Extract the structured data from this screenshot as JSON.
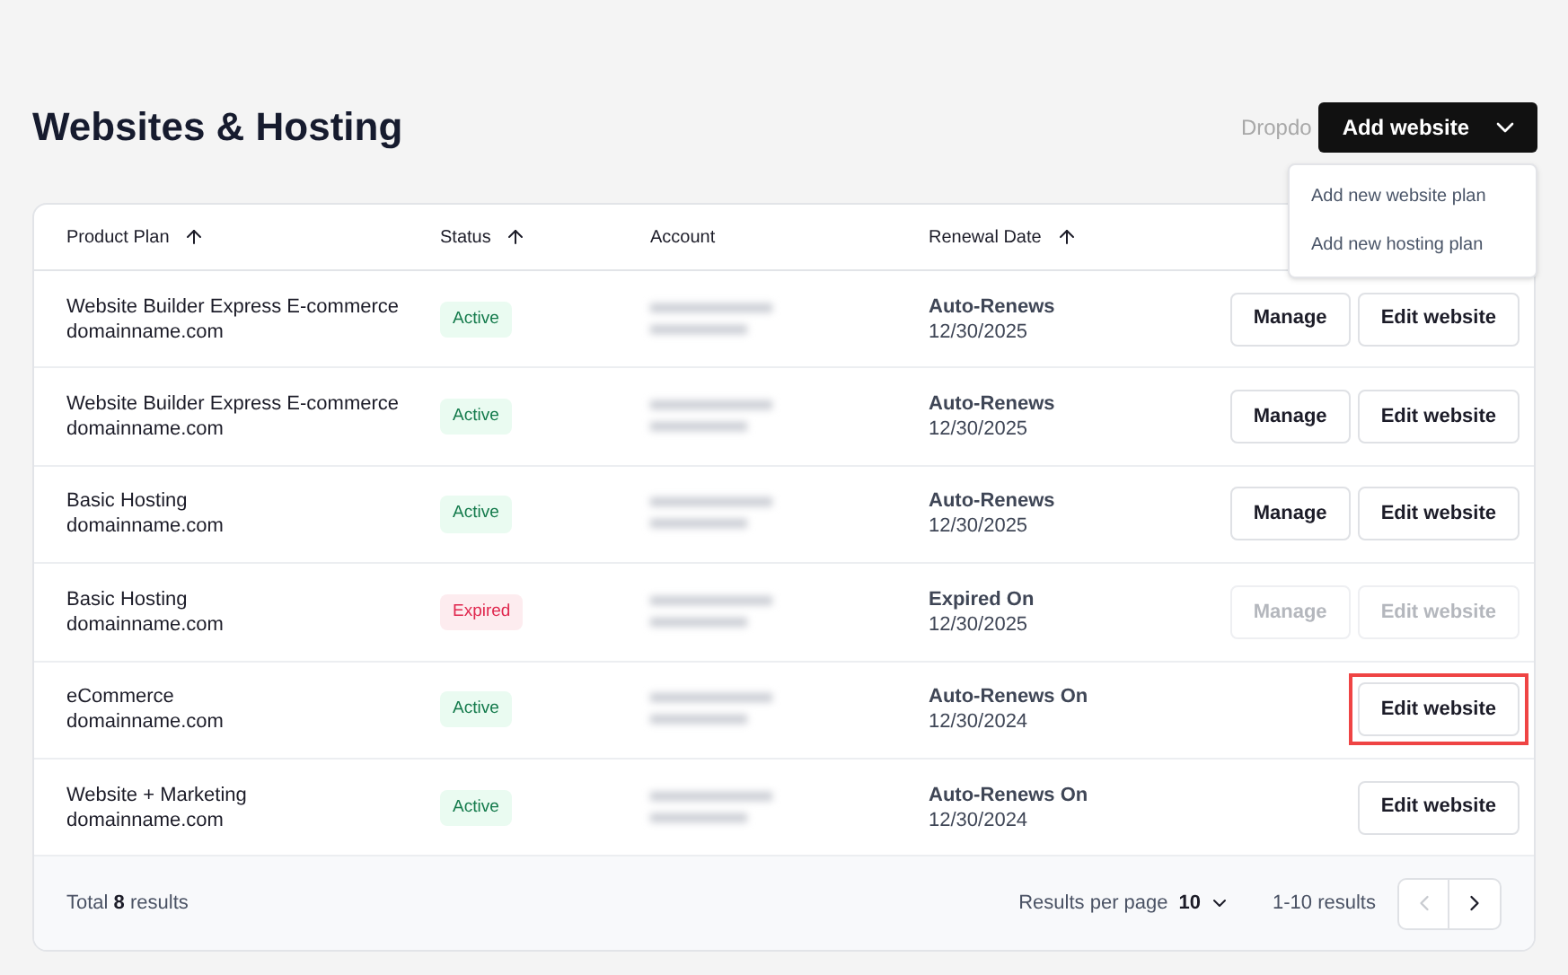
{
  "page_title": "Websites & Hosting",
  "dropdown_label": "Dropdo",
  "add_button": {
    "label": "Add website",
    "expanded": true
  },
  "menu": [
    {
      "label": "Add new website plan"
    },
    {
      "label": "Add new hosting plan"
    }
  ],
  "table": {
    "columns": [
      {
        "label": "Product Plan",
        "sortable": true
      },
      {
        "label": "Status",
        "sortable": true
      },
      {
        "label": "Account",
        "sortable": false
      },
      {
        "label": "Renewal Date",
        "sortable": true
      }
    ],
    "rows": [
      {
        "plan": "Website Builder Express E-commerce",
        "domain": "domainname.com",
        "status": {
          "label": "Active",
          "kind": "active"
        },
        "renewal": "Auto-Renews",
        "date": "12/30/2025",
        "actions": [
          {
            "label": "Manage",
            "disabled": false,
            "highlighted": false
          },
          {
            "label": "Edit website",
            "disabled": false,
            "highlighted": false
          }
        ]
      },
      {
        "plan": "Website Builder Express E-commerce",
        "domain": "domainname.com",
        "status": {
          "label": "Active",
          "kind": "active"
        },
        "renewal": "Auto-Renews",
        "date": "12/30/2025",
        "actions": [
          {
            "label": "Manage",
            "disabled": false,
            "highlighted": false
          },
          {
            "label": "Edit website",
            "disabled": false,
            "highlighted": false
          }
        ]
      },
      {
        "plan": "Basic Hosting",
        "domain": "domainname.com",
        "status": {
          "label": "Active",
          "kind": "active"
        },
        "renewal": "Auto-Renews",
        "date": "12/30/2025",
        "actions": [
          {
            "label": "Manage",
            "disabled": false,
            "highlighted": false
          },
          {
            "label": "Edit website",
            "disabled": false,
            "highlighted": false
          }
        ]
      },
      {
        "plan": "Basic Hosting",
        "domain": "domainname.com",
        "status": {
          "label": "Expired",
          "kind": "expired"
        },
        "renewal": "Expired On",
        "date": "12/30/2025",
        "actions": [
          {
            "label": "Manage",
            "disabled": true,
            "highlighted": false
          },
          {
            "label": "Edit website",
            "disabled": true,
            "highlighted": false
          }
        ]
      },
      {
        "plan": "eCommerce",
        "domain": "domainname.com",
        "status": {
          "label": "Active",
          "kind": "active"
        },
        "renewal": "Auto-Renews On",
        "date": "12/30/2024",
        "actions": [
          {
            "label": "Edit website",
            "disabled": false,
            "highlighted": true
          }
        ]
      },
      {
        "plan": "Website + Marketing",
        "domain": "domainname.com",
        "status": {
          "label": "Active",
          "kind": "active"
        },
        "renewal": "Auto-Renews On",
        "date": "12/30/2024",
        "actions": [
          {
            "label": "Edit website",
            "disabled": false,
            "highlighted": false
          }
        ]
      }
    ]
  },
  "footer": {
    "total": "Total **8** results",
    "per_page_label": "Results per page",
    "per_page_value": "10",
    "range": "1-10 results",
    "prev_disabled": true,
    "next_disabled": false
  }
}
